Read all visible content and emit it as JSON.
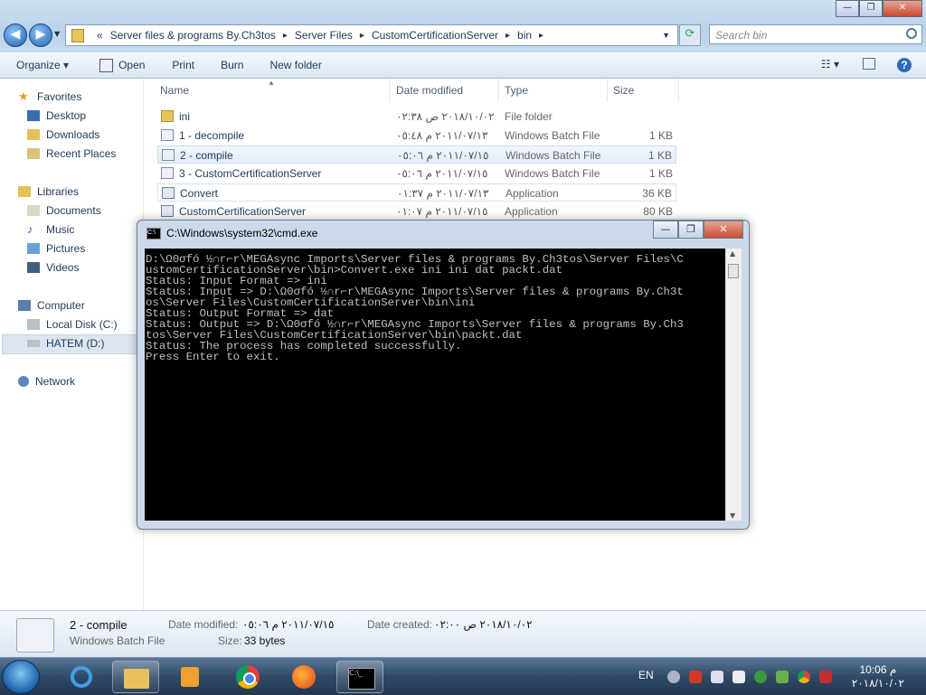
{
  "explorer": {
    "address": {
      "prefix": "«",
      "crumbs": [
        "Server files & programs By.Ch3tos",
        "Server Files",
        "CustomCertificationServer",
        "bin"
      ]
    },
    "search_placeholder": "Search bin",
    "toolbar": {
      "organize": "Organize ▾",
      "open": "Open",
      "print": "Print",
      "burn": "Burn",
      "new_folder": "New folder"
    },
    "sidebar": {
      "favorites": "Favorites",
      "desktop": "Desktop",
      "downloads": "Downloads",
      "recent": "Recent Places",
      "libraries": "Libraries",
      "documents": "Documents",
      "music": "Music",
      "pictures": "Pictures",
      "videos": "Videos",
      "computer": "Computer",
      "local_disk": "Local Disk (C:)",
      "hatem": "HATEM (D:)",
      "network": "Network"
    },
    "columns": {
      "name": "Name",
      "date": "Date modified",
      "type": "Type",
      "size": "Size"
    },
    "files": [
      {
        "name": "ini",
        "date": "٢٠١٨/١٠/٠٢ ص ٠٢:٣٨",
        "type": "File folder",
        "size": ""
      },
      {
        "name": "1 - decompile",
        "date": "٢٠١١/٠٧/١٣ م ٠٥:٤٨",
        "type": "Windows Batch File",
        "size": "1 KB"
      },
      {
        "name": "2 - compile",
        "date": "٢٠١١/٠٧/١٥ م ٠٥:٠٦",
        "type": "Windows Batch File",
        "size": "1 KB"
      },
      {
        "name": "3 - CustomCertificationServer",
        "date": "٢٠١١/٠٧/١٥ م ٠٥:٠٦",
        "type": "Windows Batch File",
        "size": "1 KB"
      },
      {
        "name": "Convert",
        "date": "٢٠١١/٠٧/١٣ م ٠١:٣٧",
        "type": "Application",
        "size": "36 KB"
      },
      {
        "name": "CustomCertificationServer",
        "date": "٢٠١١/٠٧/١٥ م ٠١:٠٧",
        "type": "Application",
        "size": "80 KB"
      }
    ],
    "details": {
      "name": "2 - compile",
      "type": "Windows Batch File",
      "modified_label": "Date modified:",
      "modified_value": "٢٠١١/٠٧/١٥ م ٠٥:٠٦",
      "created_label": "Date created:",
      "created_value": "٢٠١٨/١٠/٠٢ ص ٠٢:٠٠",
      "size_label": "Size:",
      "size_value": "33 bytes"
    }
  },
  "cmd": {
    "title": "C:\\Windows\\system32\\cmd.exe",
    "lines": [
      "D:\\Ω0σfó ½∩r⌐r\\MEGAsync Imports\\Server files & programs By.Ch3tos\\Server Files\\C",
      "ustomCertificationServer\\bin>Convert.exe ini ini dat packt.dat",
      "Status: Input Format => ini",
      "Status: Input => D:\\Ω0σfó ½∩r⌐r\\MEGAsync Imports\\Server files & programs By.Ch3t",
      "os\\Server Files\\CustomCertificationServer\\bin\\ini",
      "Status: Output Format => dat",
      "Status: Output => D:\\Ω0σfó ½∩r⌐r\\MEGAsync Imports\\Server files & programs By.Ch3",
      "tos\\Server Files\\CustomCertificationServer\\bin\\packt.dat",
      "Status: The process has completed successfully.",
      "Press Enter to exit."
    ]
  },
  "taskbar": {
    "lang": "EN",
    "time": "10:06 م",
    "date": "٢٠١٨/١٠/٠٢"
  },
  "colors": {
    "selection": "#dde6f0",
    "accent": "#1e395b",
    "console_bg": "#000000",
    "console_fg": "#c0c0c0"
  }
}
